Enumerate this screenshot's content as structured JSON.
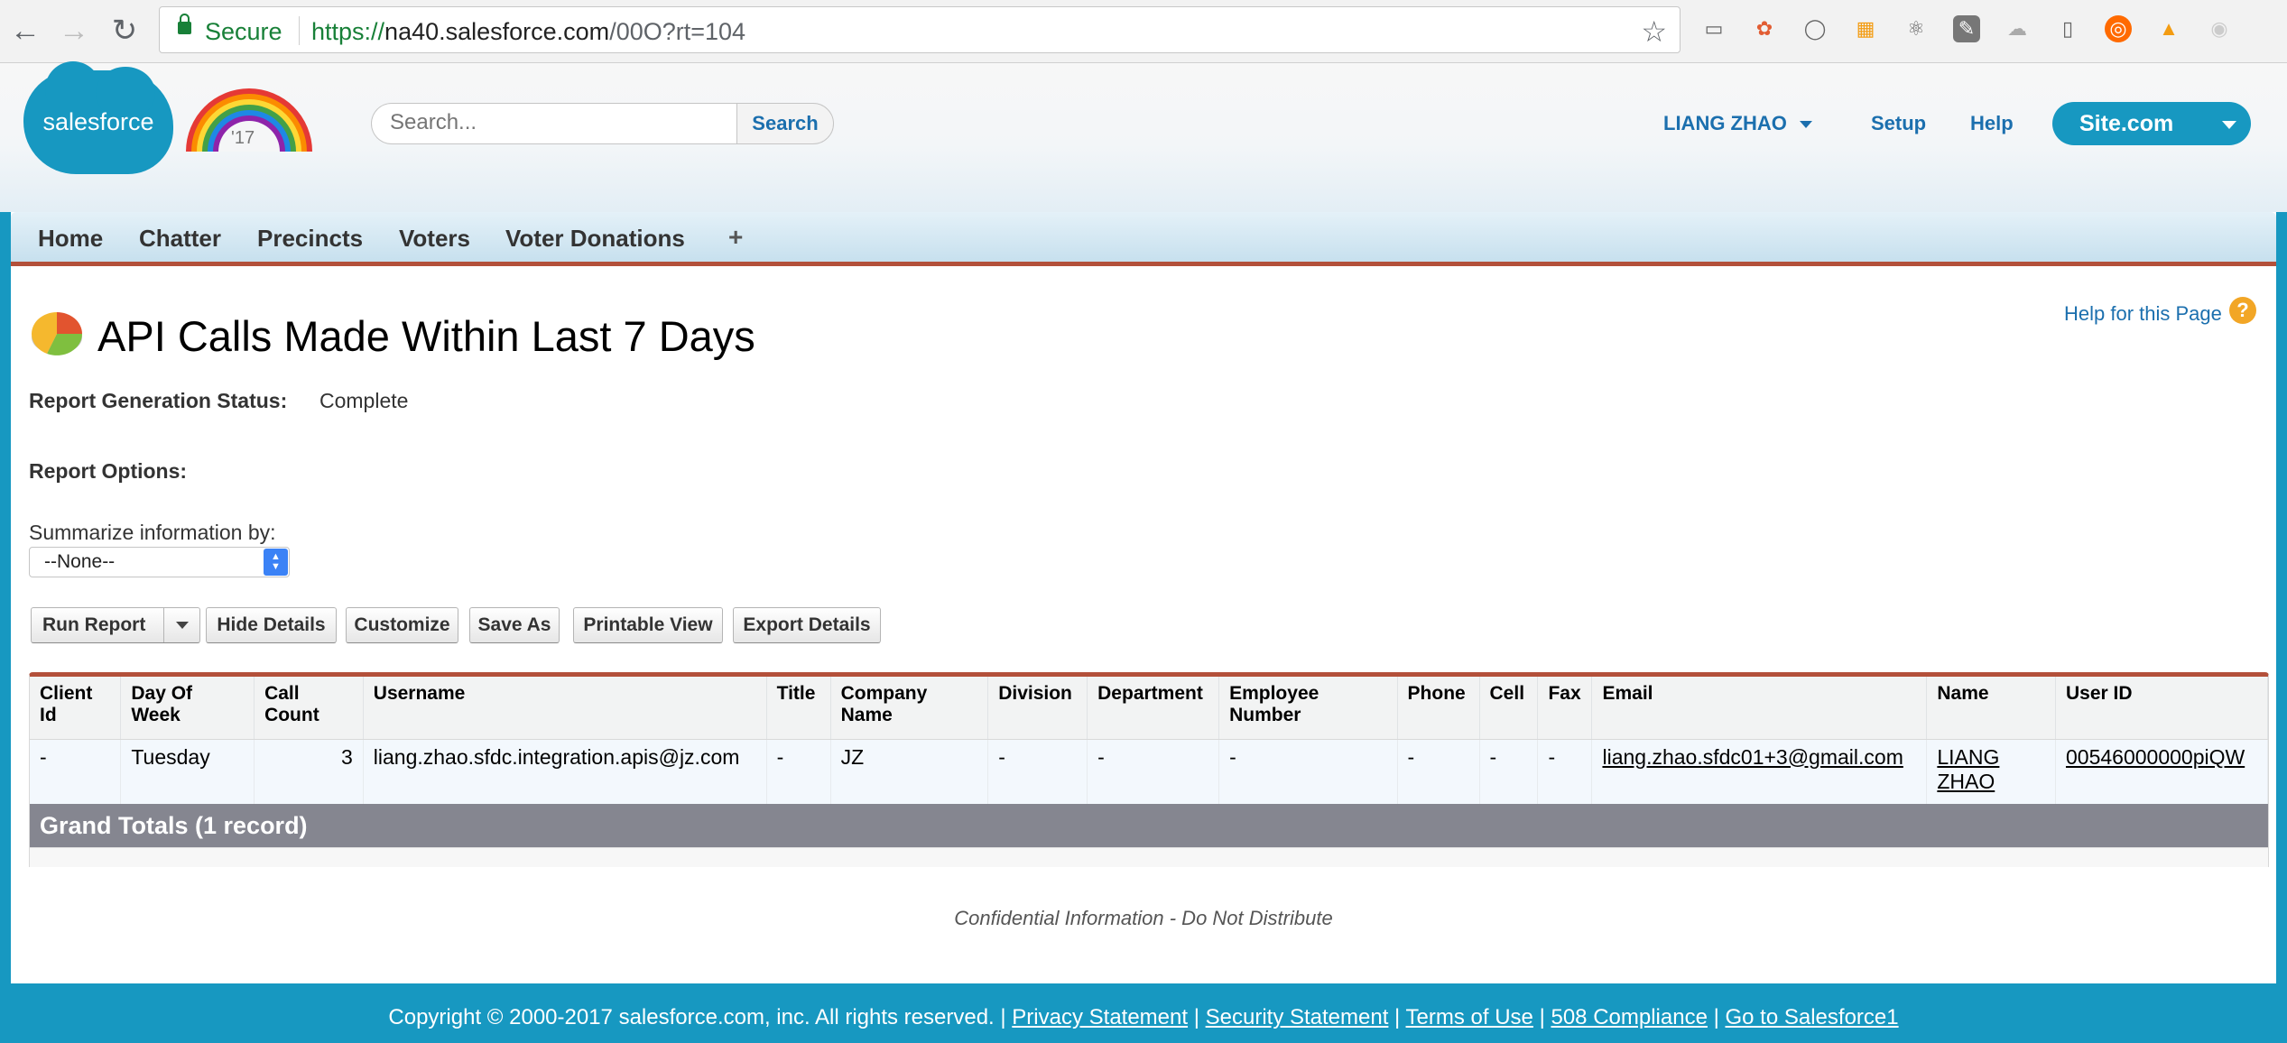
{
  "browser": {
    "secure_label": "Secure",
    "url_scheme": "https://",
    "url_host": "na40.salesforce.com",
    "url_path": "/00O?rt=104"
  },
  "header": {
    "logo_text": "salesforce",
    "rainbow_year": "'17",
    "search_placeholder": "Search...",
    "search_button": "Search",
    "user_name": "LIANG ZHAO",
    "setup": "Setup",
    "help": "Help",
    "app_switcher": "Site.com"
  },
  "tabs": [
    "Home",
    "Chatter",
    "Precincts",
    "Voters",
    "Voter Donations"
  ],
  "add_tab": "+",
  "page": {
    "title": "API Calls Made Within Last 7 Days",
    "help_link": "Help for this Page",
    "status_label": "Report Generation Status:",
    "status_value": "Complete",
    "options_label": "Report Options:",
    "summarize_label": "Summarize information by:",
    "summarize_value": "--None--"
  },
  "buttons": {
    "run_report": "Run Report",
    "hide_details": "Hide Details",
    "customize": "Customize",
    "save_as": "Save As",
    "printable_view": "Printable View",
    "export_details": "Export Details"
  },
  "table": {
    "headers": [
      "Client Id",
      "Day Of Week",
      "Call Count",
      "Username",
      "Title",
      "Company Name",
      "Division",
      "Department",
      "Employee Number",
      "Phone",
      "Cell",
      "Fax",
      "Email",
      "Name",
      "User ID"
    ],
    "rows": [
      [
        "-",
        "Tuesday",
        "3",
        "liang.zhao.sfdc.integration.apis@jz.com",
        "-",
        "JZ",
        "-",
        "-",
        "-",
        "-",
        "-",
        "-",
        "liang.zhao.sfdc01+3@gmail.com",
        "LIANG ZHAO",
        "00546000000piQW"
      ]
    ],
    "grand_totals": "Grand Totals (1 record)"
  },
  "confidential": "Confidential Information - Do Not Distribute",
  "footer": {
    "copyright": "Copyright © 2000-2017 salesforce.com, inc. All rights reserved. | ",
    "privacy": "Privacy Statement",
    "security": "Security Statement",
    "terms": "Terms of Use",
    "compliance": "508 Compliance",
    "go_sf1": "Go to Salesforce1"
  },
  "colors": {
    "brand_blue": "#1798c1",
    "link_blue": "#1b6fae",
    "tab_accent": "#b3503a",
    "grand_total_bg": "#858690"
  }
}
